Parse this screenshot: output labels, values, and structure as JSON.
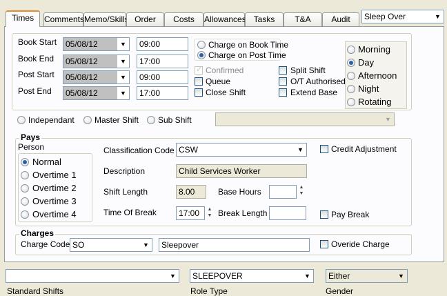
{
  "tabs": [
    {
      "label": "Times",
      "active": true
    },
    {
      "label": "Comments"
    },
    {
      "label": "Memo/Skills"
    },
    {
      "label": "Order"
    },
    {
      "label": "Costs"
    },
    {
      "label": "Allowances"
    },
    {
      "label": "Tasks"
    },
    {
      "label": "T&A"
    },
    {
      "label": "Audit"
    }
  ],
  "shift_type_select": "Sleep Over",
  "times": {
    "book_start_label": "Book Start",
    "book_start_date": "05/08/12",
    "book_start_time": "09:00",
    "book_end_label": "Book End",
    "book_end_date": "05/08/12",
    "book_end_time": "17:00",
    "post_start_label": "Post Start",
    "post_start_date": "05/08/12",
    "post_start_time": "09:00",
    "post_end_label": "Post End",
    "post_end_date": "05/08/12",
    "post_end_time": "17:00"
  },
  "charge_on": {
    "book_label": "Charge on Book Time",
    "post_label": "Charge on Post Time",
    "selected": "post"
  },
  "flags": {
    "confirmed": "Confirmed",
    "queue": "Queue",
    "close_shift": "Close Shift",
    "split_shift": "Split Shift",
    "ot_authorised": "O/T Authorised",
    "extend_base": "Extend Base"
  },
  "period": {
    "options": [
      "Morning",
      "Day",
      "Afternoon",
      "Night",
      "Rotating"
    ],
    "selected": "Day"
  },
  "shift_kind": {
    "independant": "Independant",
    "master": "Master Shift",
    "sub": "Sub Shift"
  },
  "pays": {
    "title": "Pays",
    "person_label": "Person",
    "options": [
      "Normal",
      "Overtime 1",
      "Overtime 2",
      "Overtime 3",
      "Overtime 4"
    ],
    "selected": "Normal",
    "classification_label": "Classification Code",
    "classification_value": "CSW",
    "description_label": "Description",
    "description_value": "Child Services Worker",
    "shift_length_label": "Shift Length",
    "shift_length_value": "8.00",
    "base_hours_label": "Base Hours",
    "base_hours_value": "",
    "time_of_break_label": "Time Of Break",
    "time_of_break_value": "17:00",
    "break_length_label": "Break Length",
    "break_length_value": "",
    "credit_adjustment": "Credit Adjustment",
    "pay_break": "Pay Break"
  },
  "charges": {
    "title": "Charges",
    "charge_code_label": "Charge Code",
    "charge_code_value": "SO",
    "charge_desc_value": "Sleepover",
    "override_charge": "Overide Charge"
  },
  "footer": {
    "standard_shifts_value": "",
    "standard_shifts_label": "Standard Shifts",
    "role_type_value": "SLEEPOVER",
    "role_type_label": "Role Type",
    "gender_value": "Either",
    "gender_label": "Gender"
  },
  "icons": {
    "dropdown": "chevron-down-icon",
    "spin": "spin-updown-icon"
  }
}
